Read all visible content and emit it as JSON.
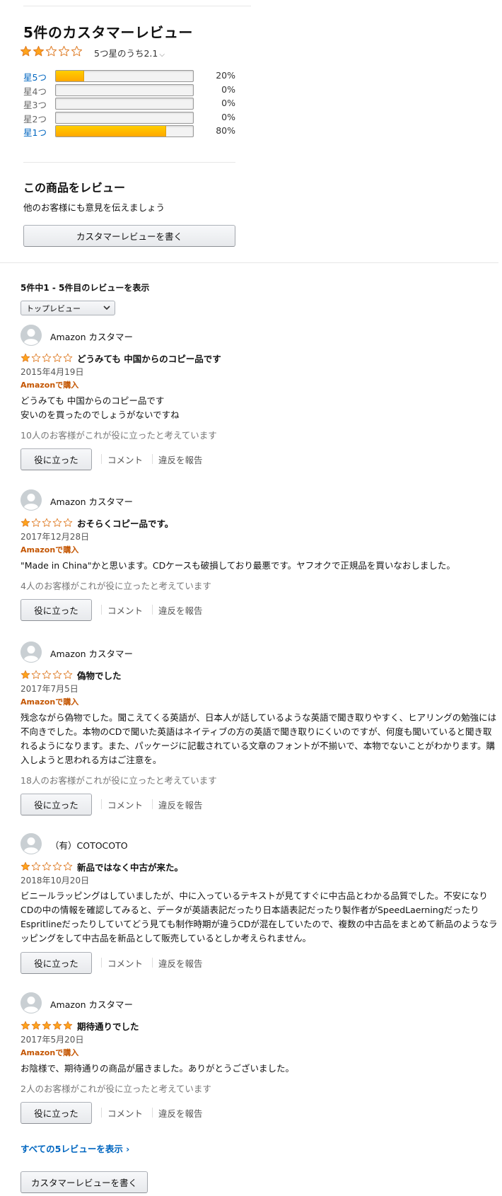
{
  "summary": {
    "title": "5件のカスタマーレビュー",
    "rating_value": 2.1,
    "rating_text": "5つ星のうち2.1",
    "histogram": [
      {
        "label": "星5つ",
        "percent": 20,
        "percent_text": "20%",
        "link": true
      },
      {
        "label": "星4つ",
        "percent": 0,
        "percent_text": "0%",
        "link": false
      },
      {
        "label": "星3つ",
        "percent": 0,
        "percent_text": "0%",
        "link": false
      },
      {
        "label": "星2つ",
        "percent": 0,
        "percent_text": "0%",
        "link": false
      },
      {
        "label": "星1つ",
        "percent": 80,
        "percent_text": "80%",
        "link": true
      }
    ]
  },
  "write_review": {
    "heading": "この商品をレビュー",
    "subtext": "他のお客様にも意見を伝えましょう",
    "button_label": "カスタマーレビューを書く"
  },
  "list": {
    "showing_text": "5件中1 - 5件目のレビューを表示",
    "sort_selected": "トップレビュー"
  },
  "reviews": [
    {
      "author": "Amazon カスタマー",
      "stars": 1,
      "title": "どうみても 中国からのコピー品です",
      "date": "2015年4月19日",
      "verified": "Amazonで購入",
      "body": [
        "どうみても 中国からのコピー品です",
        "安いのを買ったのでしょうがないですね"
      ],
      "helpful_text": "10人のお客様がこれが役に立ったと考えています"
    },
    {
      "author": "Amazon カスタマー",
      "stars": 1,
      "title": "おそらくコピー品です。",
      "date": "2017年12月28日",
      "verified": "Amazonで購入",
      "body": [
        "\"Made in China\"かと思います。CDケースも破損しており最悪です。ヤフオクで正規品を買いなおしました。"
      ],
      "helpful_text": "4人のお客様がこれが役に立ったと考えています"
    },
    {
      "author": "Amazon カスタマー",
      "stars": 1,
      "title": "偽物でした",
      "date": "2017年7月5日",
      "verified": "Amazonで購入",
      "body": [
        "残念ながら偽物でした。聞こえてくる英語が、日本人が話しているような英語で聞き取りやすく、ヒアリングの勉強には不向きでした。本物のCDで聞いた英語はネイティブの方の英語で聞き取りにくいのですが、何度も聞いていると聞き取れるようになります。また、パッケージに記載されている文章のフォントが不揃いで、本物でないことがわかります。購入しようと思われる方はご注意を。"
      ],
      "helpful_text": "18人のお客様がこれが役に立ったと考えています"
    },
    {
      "author": "（有）COTOCOTO",
      "stars": 1,
      "title": "新品ではなく中古が来た。",
      "date": "2018年10月20日",
      "verified": "",
      "body": [
        "ビニールラッピングはしていましたが、中に入っているテキストが見てすぐに中古品とわかる品質でした。不安になりCDの中の情報を確認してみると、データが英語表記だったり日本語表記だったり製作者がSpeedLaerningだったりEspritlineだったりしていてどう見ても制作時期が違うCDが混在していたので、複数の中古品をまとめて新品のようなラッピングをして中古品を新品として販売しているとしか考えられません。"
      ],
      "helpful_text": ""
    },
    {
      "author": "Amazon カスタマー",
      "stars": 5,
      "title": "期待通りでした",
      "date": "2017年5月20日",
      "verified": "Amazonで購入",
      "body": [
        "お陰様で、期待通りの商品が届きました。ありがとうございました。"
      ],
      "helpful_text": "2人のお客様がこれが役に立ったと考えています"
    }
  ],
  "actions": {
    "helpful_button": "役に立った",
    "comment": "コメント",
    "report": "違反を報告"
  },
  "footer": {
    "see_all": "すべての5レビューを表示 ›",
    "write_button": "カスタマーレビューを書く"
  },
  "colors": {
    "link": "#0066c0",
    "star_fill": "#ffa41c",
    "verified": "#c45500"
  }
}
